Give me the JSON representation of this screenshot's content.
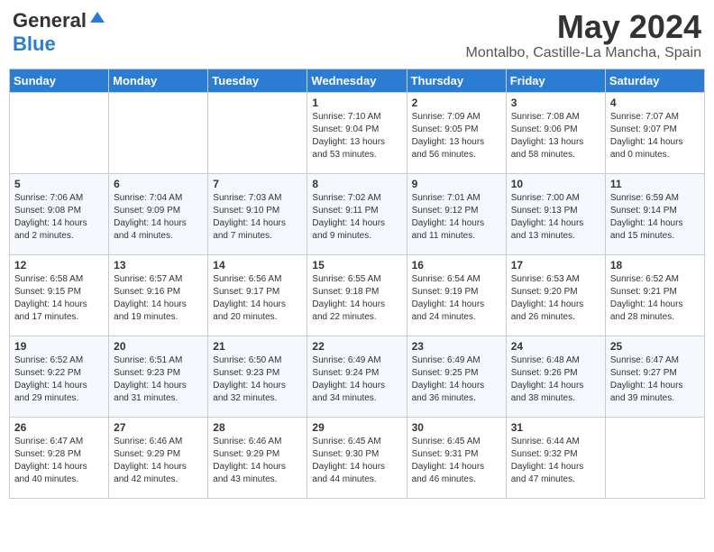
{
  "header": {
    "logo_general": "General",
    "logo_blue": "Blue",
    "title": "May 2024",
    "subtitle": "Montalbo, Castille-La Mancha, Spain"
  },
  "weekdays": [
    "Sunday",
    "Monday",
    "Tuesday",
    "Wednesday",
    "Thursday",
    "Friday",
    "Saturday"
  ],
  "weeks": [
    [
      {
        "day": "",
        "sunrise": "",
        "sunset": "",
        "daylight": ""
      },
      {
        "day": "",
        "sunrise": "",
        "sunset": "",
        "daylight": ""
      },
      {
        "day": "",
        "sunrise": "",
        "sunset": "",
        "daylight": ""
      },
      {
        "day": "1",
        "sunrise": "Sunrise: 7:10 AM",
        "sunset": "Sunset: 9:04 PM",
        "daylight": "Daylight: 13 hours and 53 minutes."
      },
      {
        "day": "2",
        "sunrise": "Sunrise: 7:09 AM",
        "sunset": "Sunset: 9:05 PM",
        "daylight": "Daylight: 13 hours and 56 minutes."
      },
      {
        "day": "3",
        "sunrise": "Sunrise: 7:08 AM",
        "sunset": "Sunset: 9:06 PM",
        "daylight": "Daylight: 13 hours and 58 minutes."
      },
      {
        "day": "4",
        "sunrise": "Sunrise: 7:07 AM",
        "sunset": "Sunset: 9:07 PM",
        "daylight": "Daylight: 14 hours and 0 minutes."
      }
    ],
    [
      {
        "day": "5",
        "sunrise": "Sunrise: 7:06 AM",
        "sunset": "Sunset: 9:08 PM",
        "daylight": "Daylight: 14 hours and 2 minutes."
      },
      {
        "day": "6",
        "sunrise": "Sunrise: 7:04 AM",
        "sunset": "Sunset: 9:09 PM",
        "daylight": "Daylight: 14 hours and 4 minutes."
      },
      {
        "day": "7",
        "sunrise": "Sunrise: 7:03 AM",
        "sunset": "Sunset: 9:10 PM",
        "daylight": "Daylight: 14 hours and 7 minutes."
      },
      {
        "day": "8",
        "sunrise": "Sunrise: 7:02 AM",
        "sunset": "Sunset: 9:11 PM",
        "daylight": "Daylight: 14 hours and 9 minutes."
      },
      {
        "day": "9",
        "sunrise": "Sunrise: 7:01 AM",
        "sunset": "Sunset: 9:12 PM",
        "daylight": "Daylight: 14 hours and 11 minutes."
      },
      {
        "day": "10",
        "sunrise": "Sunrise: 7:00 AM",
        "sunset": "Sunset: 9:13 PM",
        "daylight": "Daylight: 14 hours and 13 minutes."
      },
      {
        "day": "11",
        "sunrise": "Sunrise: 6:59 AM",
        "sunset": "Sunset: 9:14 PM",
        "daylight": "Daylight: 14 hours and 15 minutes."
      }
    ],
    [
      {
        "day": "12",
        "sunrise": "Sunrise: 6:58 AM",
        "sunset": "Sunset: 9:15 PM",
        "daylight": "Daylight: 14 hours and 17 minutes."
      },
      {
        "day": "13",
        "sunrise": "Sunrise: 6:57 AM",
        "sunset": "Sunset: 9:16 PM",
        "daylight": "Daylight: 14 hours and 19 minutes."
      },
      {
        "day": "14",
        "sunrise": "Sunrise: 6:56 AM",
        "sunset": "Sunset: 9:17 PM",
        "daylight": "Daylight: 14 hours and 20 minutes."
      },
      {
        "day": "15",
        "sunrise": "Sunrise: 6:55 AM",
        "sunset": "Sunset: 9:18 PM",
        "daylight": "Daylight: 14 hours and 22 minutes."
      },
      {
        "day": "16",
        "sunrise": "Sunrise: 6:54 AM",
        "sunset": "Sunset: 9:19 PM",
        "daylight": "Daylight: 14 hours and 24 minutes."
      },
      {
        "day": "17",
        "sunrise": "Sunrise: 6:53 AM",
        "sunset": "Sunset: 9:20 PM",
        "daylight": "Daylight: 14 hours and 26 minutes."
      },
      {
        "day": "18",
        "sunrise": "Sunrise: 6:52 AM",
        "sunset": "Sunset: 9:21 PM",
        "daylight": "Daylight: 14 hours and 28 minutes."
      }
    ],
    [
      {
        "day": "19",
        "sunrise": "Sunrise: 6:52 AM",
        "sunset": "Sunset: 9:22 PM",
        "daylight": "Daylight: 14 hours and 29 minutes."
      },
      {
        "day": "20",
        "sunrise": "Sunrise: 6:51 AM",
        "sunset": "Sunset: 9:23 PM",
        "daylight": "Daylight: 14 hours and 31 minutes."
      },
      {
        "day": "21",
        "sunrise": "Sunrise: 6:50 AM",
        "sunset": "Sunset: 9:23 PM",
        "daylight": "Daylight: 14 hours and 32 minutes."
      },
      {
        "day": "22",
        "sunrise": "Sunrise: 6:49 AM",
        "sunset": "Sunset: 9:24 PM",
        "daylight": "Daylight: 14 hours and 34 minutes."
      },
      {
        "day": "23",
        "sunrise": "Sunrise: 6:49 AM",
        "sunset": "Sunset: 9:25 PM",
        "daylight": "Daylight: 14 hours and 36 minutes."
      },
      {
        "day": "24",
        "sunrise": "Sunrise: 6:48 AM",
        "sunset": "Sunset: 9:26 PM",
        "daylight": "Daylight: 14 hours and 38 minutes."
      },
      {
        "day": "25",
        "sunrise": "Sunrise: 6:47 AM",
        "sunset": "Sunset: 9:27 PM",
        "daylight": "Daylight: 14 hours and 39 minutes."
      }
    ],
    [
      {
        "day": "26",
        "sunrise": "Sunrise: 6:47 AM",
        "sunset": "Sunset: 9:28 PM",
        "daylight": "Daylight: 14 hours and 40 minutes."
      },
      {
        "day": "27",
        "sunrise": "Sunrise: 6:46 AM",
        "sunset": "Sunset: 9:29 PM",
        "daylight": "Daylight: 14 hours and 42 minutes."
      },
      {
        "day": "28",
        "sunrise": "Sunrise: 6:46 AM",
        "sunset": "Sunset: 9:29 PM",
        "daylight": "Daylight: 14 hours and 43 minutes."
      },
      {
        "day": "29",
        "sunrise": "Sunrise: 6:45 AM",
        "sunset": "Sunset: 9:30 PM",
        "daylight": "Daylight: 14 hours and 44 minutes."
      },
      {
        "day": "30",
        "sunrise": "Sunrise: 6:45 AM",
        "sunset": "Sunset: 9:31 PM",
        "daylight": "Daylight: 14 hours and 46 minutes."
      },
      {
        "day": "31",
        "sunrise": "Sunrise: 6:44 AM",
        "sunset": "Sunset: 9:32 PM",
        "daylight": "Daylight: 14 hours and 47 minutes."
      },
      {
        "day": "",
        "sunrise": "",
        "sunset": "",
        "daylight": ""
      }
    ]
  ]
}
